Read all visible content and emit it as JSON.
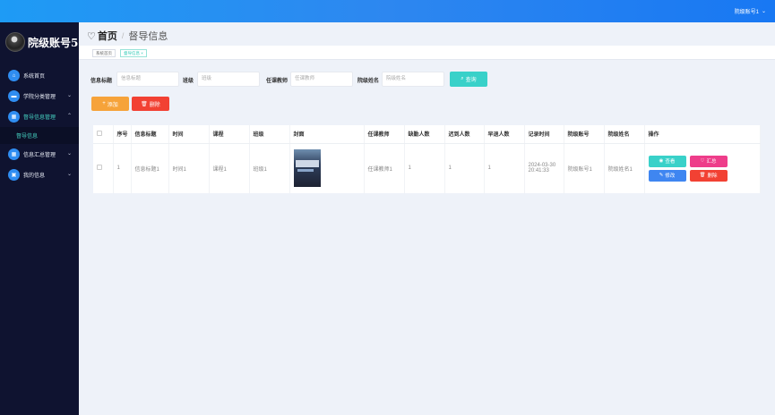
{
  "topbar": {
    "user_label": "院级账号1",
    "chevron_icon": "chevron-down-icon"
  },
  "sidebar": {
    "brand_title": "院级账号5",
    "items": [
      {
        "label": "系统首页",
        "icon": "home-icon",
        "has_caret": false
      },
      {
        "label": "学院分类管理",
        "icon": "folder-icon",
        "has_caret": true
      },
      {
        "label": "督导信息管理",
        "icon": "grid-icon",
        "has_caret": true,
        "active": true
      },
      {
        "label": "信息汇总管理",
        "icon": "grid-icon",
        "has_caret": true
      },
      {
        "label": "我的信息",
        "icon": "user-card-icon",
        "has_caret": true
      }
    ],
    "submenu": {
      "label": "督导信息"
    }
  },
  "header": {
    "home": "首页",
    "separator": "/",
    "current": "督导信息"
  },
  "tags": {
    "tag1": "系统首页",
    "tag2": "督导信息 ×"
  },
  "search": {
    "fields": [
      {
        "label": "信息标题",
        "placeholder": "信息标题"
      },
      {
        "label": "班级",
        "placeholder": "班级"
      },
      {
        "label": "任课教师",
        "placeholder": "任课教师"
      },
      {
        "label": "院级姓名",
        "placeholder": "院级姓名"
      }
    ],
    "button_label": "查询"
  },
  "actions": {
    "add_label": "添加",
    "delete_label": "删除"
  },
  "table": {
    "columns": [
      "",
      "序号",
      "信息标题",
      "时间",
      "课程",
      "班级",
      "封面",
      "任课教师",
      "缺勤人数",
      "迟到人数",
      "早退人数",
      "记录时间",
      "院级账号",
      "院级姓名",
      "操作"
    ],
    "rows": [
      {
        "index": "1",
        "title": "信息标题1",
        "time": "时间1",
        "course": "课程1",
        "class": "班级1",
        "teacher": "任课教师1",
        "absent": "1",
        "late": "1",
        "early": "1",
        "record_time": "2024-03-30 20:41:33",
        "account": "院级账号1",
        "name": "院级姓名1"
      }
    ],
    "ops": {
      "view": "查看",
      "summary": "汇总",
      "edit": "修改",
      "delete": "删除"
    }
  },
  "colors": {
    "accent": "#2d87f0",
    "teal": "#39d1c9",
    "orange": "#f6a33a",
    "red": "#f24133",
    "pink": "#ee3d8a",
    "sidebar_bg": "#0f1330"
  }
}
